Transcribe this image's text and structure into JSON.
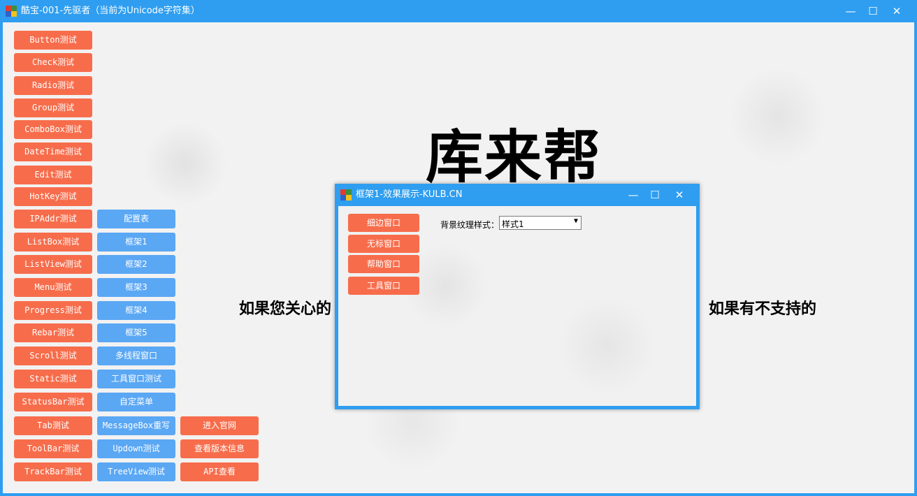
{
  "window": {
    "title": "酷宝-001-先驱者（当前为Unicode字符集）",
    "controls": {
      "minimize": "—",
      "maximize": "☐",
      "close": "✕"
    }
  },
  "colors": {
    "titlebar": "#2f9ef0",
    "red_button": "#f76d4c",
    "blue_button": "#5aa7f4"
  },
  "left_column": [
    "Button测试",
    "Check测试",
    "Radio测试",
    "Group测试",
    "ComboBox测试",
    "DateTime测试",
    "Edit测试",
    "HotKey测试",
    "IPAddr测试",
    "ListBox测试",
    "ListView测试",
    "Menu测试",
    "Progress测试",
    "Rebar测试",
    "Scroll测试",
    "Static测试",
    "StatusBar测试",
    "Tab测试",
    "ToolBar测试",
    "TrackBar测试"
  ],
  "middle_column": [
    "配置表",
    "框架1",
    "框架2",
    "框架3",
    "框架4",
    "框架5",
    "多线程窗口",
    "工具窗口测试",
    "自定菜单",
    "MessageBox重写",
    "Updown测试",
    "TreeView测试"
  ],
  "right_column": [
    "进入官网",
    "查看版本信息",
    "API查看"
  ],
  "banner": {
    "title": "库来帮",
    "notice_left": "如果您关心的",
    "notice_right": "如果有不支持的"
  },
  "child_window": {
    "title": "框架1-效果展示-KULB.CN",
    "controls": {
      "minimize": "—",
      "maximize": "☐",
      "close": "✕"
    },
    "buttons": [
      "细边窗口",
      "无标窗口",
      "帮助窗口",
      "工具窗口"
    ],
    "texture_label": "背景纹理样式：",
    "texture_value": "样式1"
  }
}
